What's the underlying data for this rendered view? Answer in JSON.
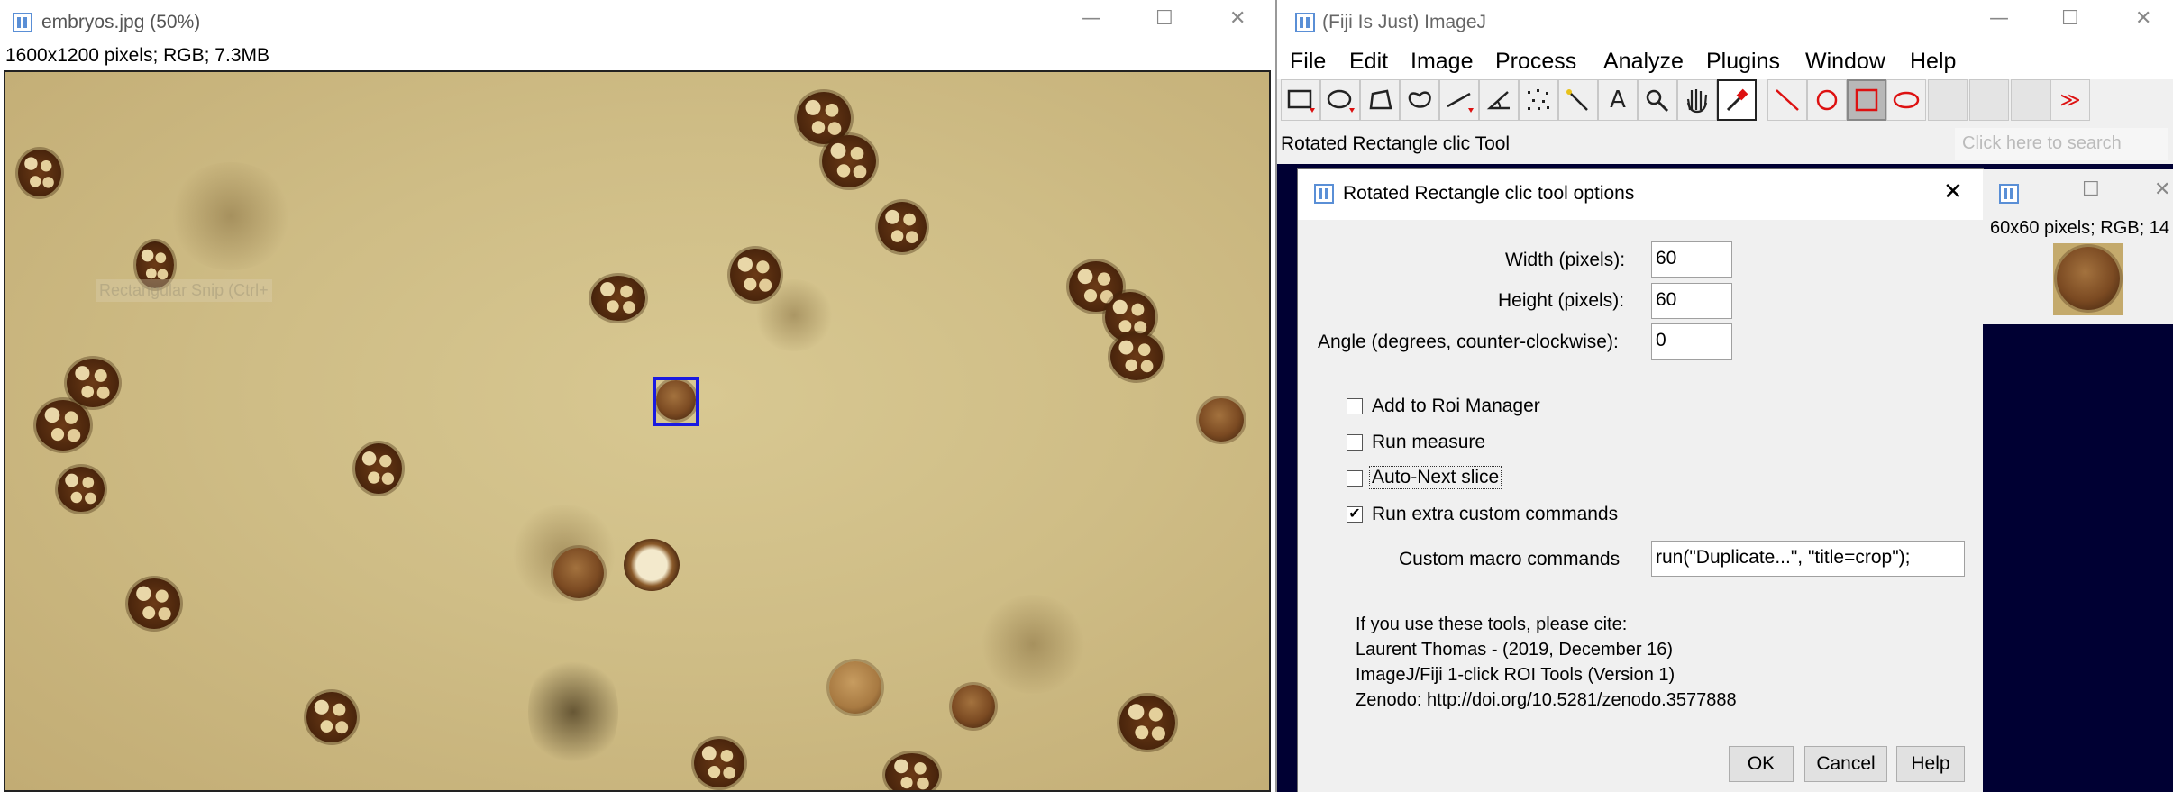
{
  "image_window": {
    "title": "embryos.jpg (50%)",
    "info": "1600x1200 pixels; RGB; 7.3MB",
    "controls": {
      "minimize": "—",
      "maximize": "☐",
      "close": "✕"
    },
    "overlay_text": "Rectangular Snip (Ctrl+"
  },
  "imagej": {
    "title": "(Fiji Is Just) ImageJ",
    "menu": [
      "File",
      "Edit",
      "Image",
      "Process",
      "Analyze",
      "Plugins",
      "Window",
      "Help"
    ],
    "status": "Rotated Rectangle clic Tool",
    "search_placeholder": "Click here to search",
    "tools": [
      {
        "name": "rectangle-tool-icon",
        "glyph": "▭"
      },
      {
        "name": "oval-tool-icon",
        "glyph": "◯"
      },
      {
        "name": "polygon-tool-icon",
        "glyph": "⬠"
      },
      {
        "name": "freehand-tool-icon",
        "glyph": "ᗝ"
      },
      {
        "name": "line-tool-icon",
        "glyph": "⁄"
      },
      {
        "name": "angle-tool-icon",
        "glyph": "∠"
      },
      {
        "name": "point-tool-icon",
        "glyph": "⁘"
      },
      {
        "name": "wand-tool-icon",
        "glyph": "⁄"
      },
      {
        "name": "text-tool-icon",
        "glyph": "A"
      },
      {
        "name": "magnifier-tool-icon",
        "glyph": "🔍"
      },
      {
        "name": "hand-tool-icon",
        "glyph": "✋"
      },
      {
        "name": "dropper-tool-icon",
        "glyph": "✎"
      },
      {
        "name": "line-clic-tool-icon",
        "glyph": "╲"
      },
      {
        "name": "circle-clic-tool-icon",
        "glyph": "○"
      },
      {
        "name": "rotated-rectangle-clic-tool-icon",
        "glyph": "□"
      },
      {
        "name": "ellipse-clic-tool-icon",
        "glyph": "⬭"
      },
      {
        "name": "empty-slot-1",
        "glyph": ""
      },
      {
        "name": "empty-slot-2",
        "glyph": ""
      },
      {
        "name": "empty-slot-3",
        "glyph": ""
      },
      {
        "name": "more-tools-icon",
        "glyph": "≫"
      }
    ]
  },
  "dialog": {
    "title": "Rotated Rectangle clic tool options",
    "width_label": "Width (pixels):",
    "width_value": "60",
    "height_label": "Height (pixels):",
    "height_value": "60",
    "angle_label": "Angle (degrees, counter-clockwise):",
    "angle_value": "0",
    "options": [
      {
        "label": "Add to Roi Manager",
        "checked": false
      },
      {
        "label": "Run measure",
        "checked": false
      },
      {
        "label": "Auto-Next slice",
        "checked": false
      },
      {
        "label": "Run extra custom commands",
        "checked": true
      }
    ],
    "macro_label": "Custom macro commands",
    "macro_value": "run(\"Duplicate...\", \"title=crop\");",
    "cite": [
      "If you use these tools, please cite:",
      "Laurent Thomas - (2019, December 16)",
      "ImageJ/Fiji 1-click ROI Tools (Version 1)",
      "Zenodo: http://doi.org/10.5281/zenodo.3577888"
    ],
    "ok": "OK",
    "cancel": "Cancel",
    "help": "Help"
  },
  "crop_window": {
    "info": "60x60 pixels; RGB; 14"
  }
}
